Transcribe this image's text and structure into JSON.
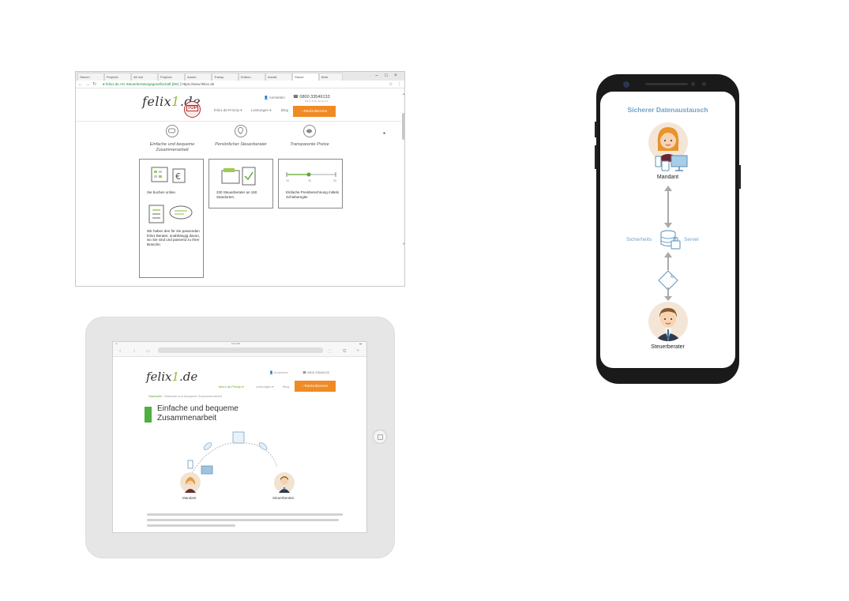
{
  "browser": {
    "tabs": [
      "Steuer!",
      "Projects",
      "All Inst",
      "Projects",
      "Adobe",
      "Transp",
      "Entheo",
      "Installi",
      "Steuer",
      "Beitr"
    ],
    "window_controls": {
      "minimize": "–",
      "maximize": "□",
      "close": "×"
    },
    "url_org": "felix1.de AG Steuerberatungsgesellschaft [DE]",
    "url": "https://www.felix1.de",
    "logo_text": "felix",
    "logo_one": "1",
    "logo_tld": ".de",
    "badge": "TOP",
    "login": "Anmelden",
    "phone": "0800 33549133",
    "phone_sub": "Mo-Fr 8-18, Sa 10-14",
    "nav": [
      "felix1.de-Prinzip ▾",
      "Leistungen ▾",
      "Blog"
    ],
    "callback": "Rückrufservice",
    "features": [
      {
        "title": "Einfache und bequeme Zusammenarbeit",
        "icon": "chat-bubble-icon"
      },
      {
        "title": "Persönlicher Steuerberater",
        "icon": "location-pin-icon"
      },
      {
        "title": "Transparente Preise",
        "icon": "piggy-bank-icon"
      }
    ],
    "cards": {
      "card1_text1": "Sie buchen online.",
      "card1_text2": "Wir haben den für Sie passenden felix1 Berater, unabhängig davon, wo Sie sind und passend zu Ihrer Branche.",
      "card2_text": "230 Steuerberater an 150 Standorten.",
      "card3_text": "Einfache Preisberechnung mittels Schieberegler.",
      "slider_min": "10",
      "slider_mid": "15",
      "slider_max": "20"
    }
  },
  "tablet": {
    "status_time": "9:41 AM",
    "logo_text": "felix",
    "logo_one": "1",
    "logo_tld": ".de",
    "login": "Anmelden",
    "phone": "0800 33549133",
    "nav": [
      "felix1.de-Prinzip ▾",
      "Leistungen ▾",
      "Blog"
    ],
    "callback": "Rückrufservice",
    "breadcrumb_home": "Startseite",
    "breadcrumb_current": "Einfache und bequeme Zusammenarbeit",
    "heading": "Einfache und bequeme Zusammenarbeit",
    "label_left": "Mandant",
    "label_right": "Steuerberater"
  },
  "phone": {
    "title": "Sicherer Datenaustausch",
    "mandant": "Mandant",
    "sicherheits": "Sicherheits",
    "server": "Server",
    "steuerberater": "Steuerberater"
  },
  "colors": {
    "brand_green": "#8bbf2e",
    "accent_orange": "#f08a24",
    "secure_blue": "#6fa3c9",
    "heading_green": "#4caf3e"
  }
}
